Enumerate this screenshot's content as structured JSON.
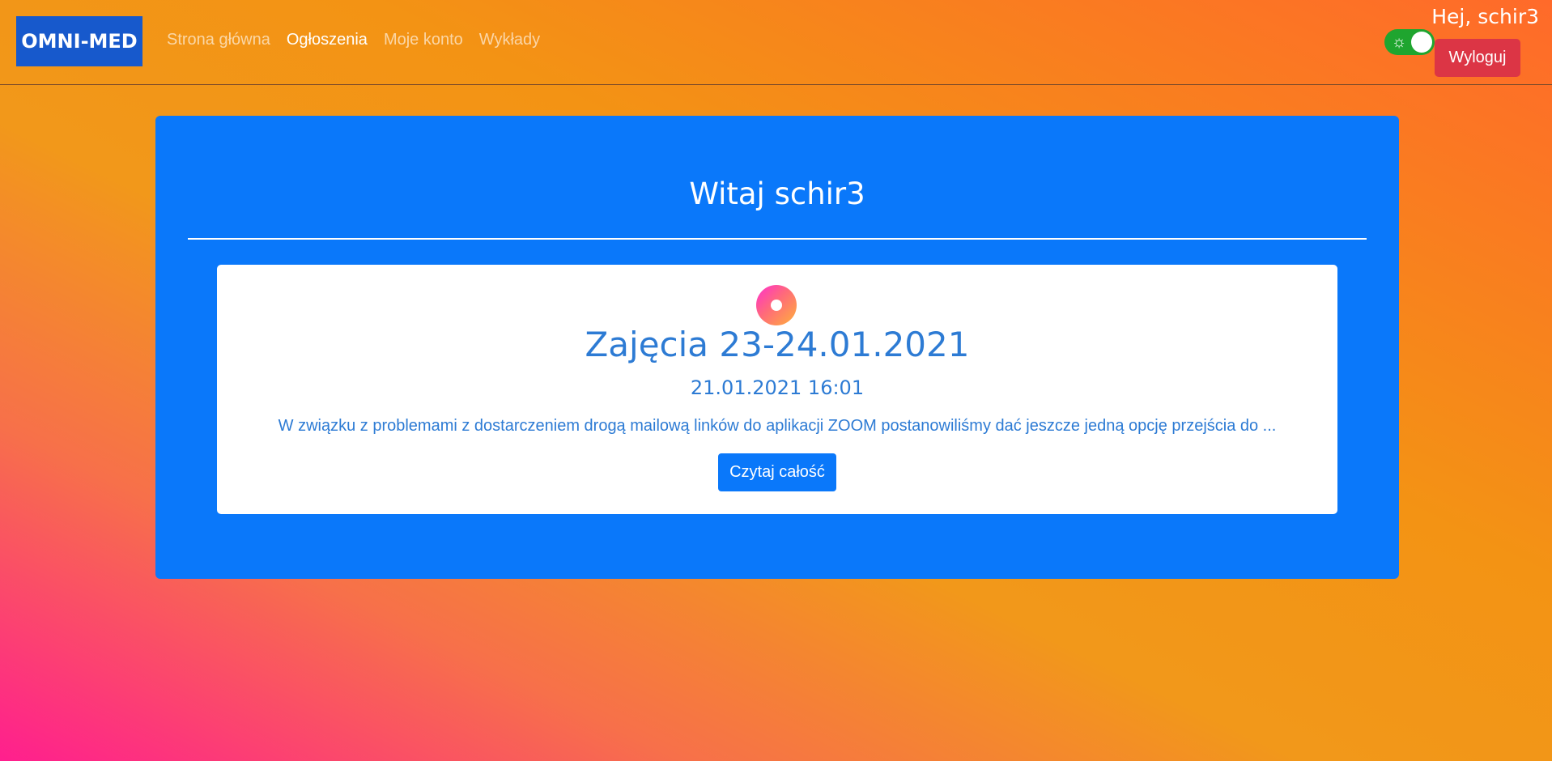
{
  "navbar": {
    "brand": "OMNI-MED",
    "links": [
      {
        "label": "Strona główna",
        "active": false
      },
      {
        "label": "Ogłoszenia",
        "active": true
      },
      {
        "label": "Moje konto",
        "active": false
      },
      {
        "label": "Wykłady",
        "active": false
      }
    ],
    "greeting": "Hej, schir3",
    "theme_toggle": {
      "icon": "sun-icon",
      "on": true,
      "color": "#1fa52f"
    },
    "logout_label": "Wyloguj"
  },
  "main": {
    "welcome_title": "Witaj schir3",
    "announcement": {
      "icon": "announcement-logo-icon",
      "title": "Zajęcia 23-24.01.2021",
      "date": "21.01.2021 16:01",
      "excerpt": "W związku z problemami z dostarczeniem drogą mailową linków do aplikacji ZOOM postanowiliśmy dać jeszcze jedną opcję przejścia do ...",
      "read_more_label": "Czytaj całość"
    }
  },
  "colors": {
    "brand_bg": "#1759cc",
    "jumbotron_bg": "#0a78fa",
    "logout_bg": "#dc3545",
    "card_text": "#2d7bd4"
  }
}
